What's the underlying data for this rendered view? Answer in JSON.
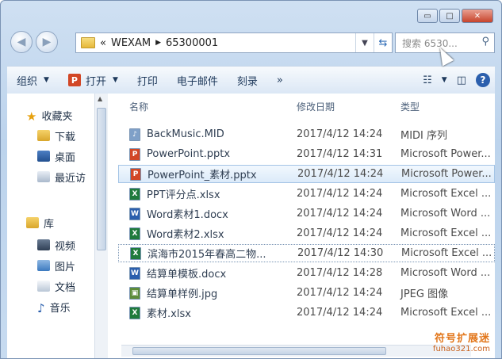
{
  "address": {
    "prefix": "«",
    "path": [
      "WEXAM",
      "65300001"
    ]
  },
  "search": {
    "placeholder": "搜索 6530..."
  },
  "toolbar": {
    "organize": "组织",
    "open": "打开",
    "print": "打印",
    "email": "电子邮件",
    "burn": "刻录",
    "more": "»"
  },
  "nav": {
    "favorites": "收藏夹",
    "downloads": "下载",
    "desktop": "桌面",
    "recent": "最近访",
    "library": "库",
    "videos": "视频",
    "pictures": "图片",
    "documents": "文档",
    "music": "音乐"
  },
  "columns": {
    "name": "名称",
    "date": "修改日期",
    "type": "类型"
  },
  "files": [
    {
      "name": "BackMusic.MID",
      "date": "2017/4/12 14:24",
      "type": "MIDI 序列",
      "icon": "midi-file-icon",
      "color": "#7fa0c8",
      "glyph": "♪"
    },
    {
      "name": "PowerPoint.pptx",
      "date": "2017/4/12 14:31",
      "type": "Microsoft Power...",
      "icon": "pptx-file-icon",
      "color": "#d24726",
      "glyph": "P"
    },
    {
      "name": "PowerPoint_素材.pptx",
      "date": "2017/4/12 14:24",
      "type": "Microsoft Power...",
      "icon": "pptx-file-icon",
      "color": "#d24726",
      "glyph": "P",
      "selected": true
    },
    {
      "name": "PPT评分点.xlsx",
      "date": "2017/4/12 14:24",
      "type": "Microsoft Excel ...",
      "icon": "xlsx-file-icon",
      "color": "#1f7a3c",
      "glyph": "X"
    },
    {
      "name": "Word素材1.docx",
      "date": "2017/4/12 14:24",
      "type": "Microsoft Word ...",
      "icon": "docx-file-icon",
      "color": "#2b5fad",
      "glyph": "W"
    },
    {
      "name": "Word素材2.xlsx",
      "date": "2017/4/12 14:24",
      "type": "Microsoft Excel ...",
      "icon": "xlsx-file-icon",
      "color": "#1f7a3c",
      "glyph": "X"
    },
    {
      "name": "滨海市2015年春高二物...",
      "date": "2017/4/12 14:30",
      "type": "Microsoft Excel ...",
      "icon": "xlsx-file-icon",
      "color": "#1f7a3c",
      "glyph": "X",
      "outlined": true
    },
    {
      "name": "结算单模板.docx",
      "date": "2017/4/12 14:28",
      "type": "Microsoft Word ...",
      "icon": "docx-file-icon",
      "color": "#2b5fad",
      "glyph": "W"
    },
    {
      "name": "结算单样例.jpg",
      "date": "2017/4/12 14:24",
      "type": "JPEG 图像",
      "icon": "jpg-file-icon",
      "color": "#5d8c3a",
      "glyph": "▣"
    },
    {
      "name": "素材.xlsx",
      "date": "2017/4/12 14:24",
      "type": "Microsoft Excel ...",
      "icon": "xlsx-file-icon",
      "color": "#1f7a3c",
      "glyph": "X"
    }
  ],
  "watermark": {
    "line1": "符号扩展迷",
    "line2": "fuhao321.com"
  }
}
